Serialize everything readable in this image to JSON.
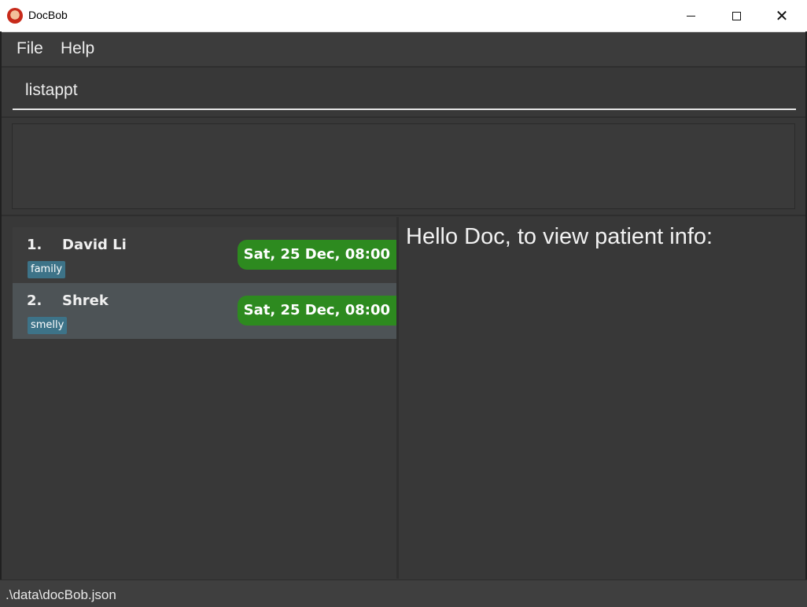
{
  "window": {
    "title": "DocBob",
    "icon": "docbob-app-icon"
  },
  "menu": {
    "file": "File",
    "help": "Help"
  },
  "command": {
    "value": "listappt",
    "placeholder": ""
  },
  "result": {
    "text": ""
  },
  "patients": [
    {
      "index": "1.",
      "name": "David Li",
      "tag": "family",
      "appointment": "Sat, 25 Dec, 08:00"
    },
    {
      "index": "2.",
      "name": "Shrek",
      "tag": "smelly",
      "appointment": "Sat, 25 Dec, 08:00"
    }
  ],
  "info_panel": {
    "message": "Hello Doc, to view patient info:"
  },
  "status": {
    "path": ".\\data\\docBob.json"
  },
  "colors": {
    "background": "#383838",
    "tag": "#3d7388",
    "appointment": "#2d8a1f",
    "selected_row": "#4d5356"
  }
}
